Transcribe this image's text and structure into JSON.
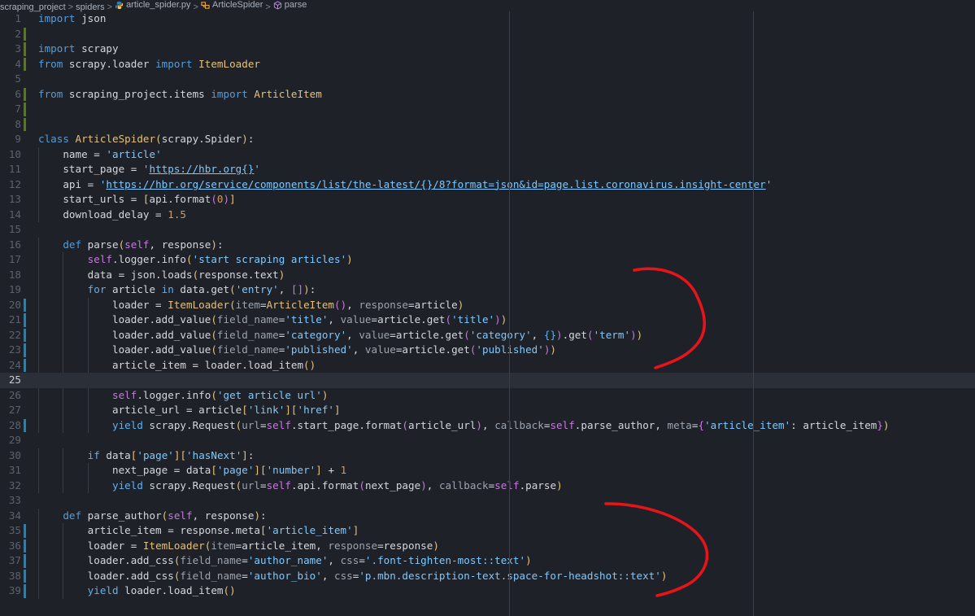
{
  "breadcrumb": {
    "items": [
      "scraping_project",
      "spiders",
      "article_spider.py",
      "ArticleSpider",
      "parse"
    ],
    "separator": ">"
  },
  "editor": {
    "current_line": 25,
    "line_numbers": [
      "1",
      "2",
      "3",
      "4",
      "5",
      "6",
      "7",
      "8",
      "9",
      "10",
      "11",
      "12",
      "13",
      "14",
      "15",
      "16",
      "17",
      "18",
      "19",
      "20",
      "21",
      "22",
      "23",
      "24",
      "25",
      "26",
      "27",
      "28",
      "29",
      "30",
      "31",
      "32",
      "33",
      "34",
      "35",
      "36",
      "37",
      "38",
      "39"
    ],
    "change_markers": {
      "added": [
        2,
        3,
        4,
        6,
        7,
        8
      ],
      "modified": [
        20,
        21,
        22,
        23,
        24,
        28,
        35,
        36,
        37,
        38,
        39
      ]
    },
    "code_lines": [
      "import json",
      "",
      "import scrapy",
      "from scrapy.loader import ItemLoader",
      "",
      "from scraping_project.items import ArticleItem",
      "",
      "",
      "class ArticleSpider(scrapy.Spider):",
      "    name = 'article'",
      "    start_page = 'https://hbr.org{}'",
      "    api = 'https://hbr.org/service/components/list/the-latest/{}/8?format=json&id=page.list.coronavirus.insight-center'",
      "    start_urls = [api.format(0)]",
      "    download_delay = 1.5",
      "",
      "    def parse(self, response):",
      "        self.logger.info('start scraping articles')",
      "        data = json.loads(response.text)",
      "        for article in data.get('entry', []):",
      "            loader = ItemLoader(item=ArticleItem(), response=article)",
      "            loader.add_value(field_name='title', value=article.get('title'))",
      "            loader.add_value(field_name='category', value=article.get('category', {}).get('term'))",
      "            loader.add_value(field_name='published', value=article.get('published'))",
      "            article_item = loader.load_item()",
      "",
      "            self.logger.info('get article url')",
      "            article_url = article['link']['href']",
      "            yield scrapy.Request(url=self.start_page.format(article_url), callback=self.parse_author, meta={'article_item': article_item})",
      "",
      "        if data['page']['hasNext']:",
      "            next_page = data['page']['number'] + 1",
      "            yield scrapy.Request(url=self.api.format(next_page), callback=self.parse)",
      "",
      "    def parse_author(self, response):",
      "        article_item = response.meta['article_item']",
      "        loader = ItemLoader(item=article_item, response=response)",
      "        loader.add_css(field_name='author_name', css='.font-tighten-most::text')",
      "        loader.add_css(field_name='author_bio', css='p.mbn.description-text.space-for-headshot::text')",
      "        yield loader.load_item()"
    ]
  },
  "colors": {
    "background": "#1e2228",
    "current_line": "#2b2f37",
    "keyword": "#569cd6",
    "string": "#7dc8ff",
    "class_name": "#e5c07b",
    "number": "#d19a66",
    "added_marker": "#587c0c",
    "modified_marker": "#1a85b8",
    "annotation": "#e8141a"
  },
  "annotations": [
    {
      "shape": "red-curly-bracket",
      "covers_lines": [
        17,
        24
      ]
    },
    {
      "shape": "red-curly-bracket",
      "covers_lines": [
        33,
        39
      ]
    }
  ]
}
